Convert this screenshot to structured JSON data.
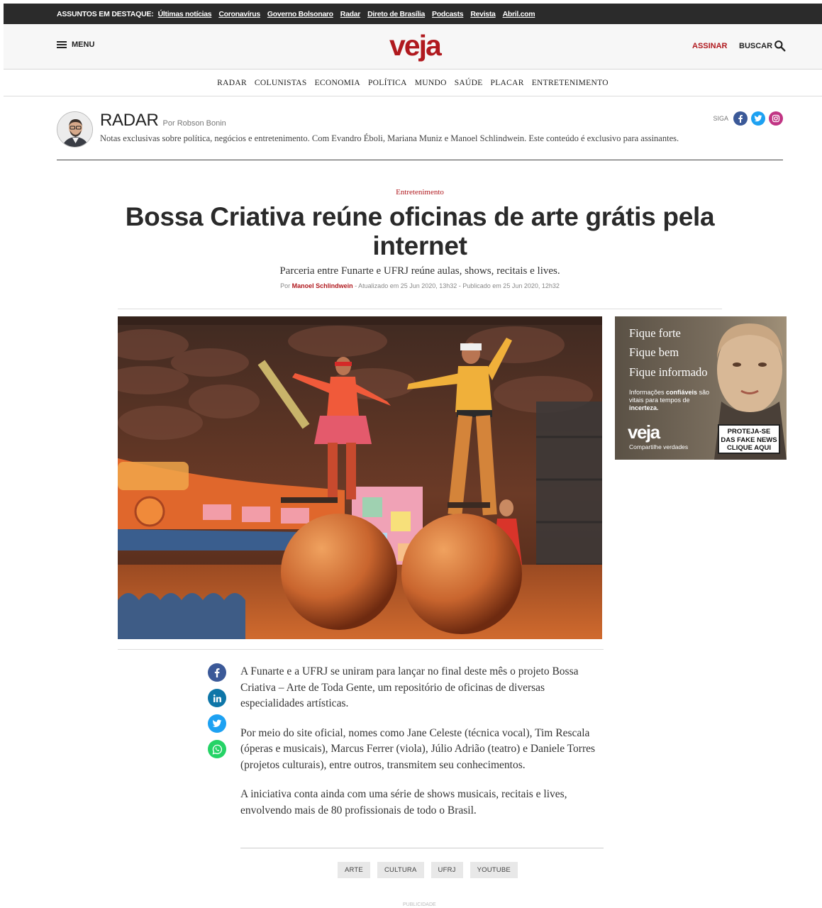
{
  "topbar": {
    "label": "ASSUNTOS EM DESTAQUE:",
    "links": [
      "Últimas notícias",
      "Coronavírus",
      "Governo Bolsonaro",
      "Radar",
      "Direto de Brasília",
      "Podcasts",
      "Revista",
      "Abril.com"
    ]
  },
  "header": {
    "menu_label": "MENU",
    "logo": "veja",
    "subscribe_label": "ASSINAR",
    "search_label": "BUSCAR"
  },
  "nav": [
    "RADAR",
    "COLUNISTAS",
    "ECONOMIA",
    "POLÍTICA",
    "MUNDO",
    "SAÚDE",
    "PLACAR",
    "ENTRETENIMENTO"
  ],
  "column": {
    "title": "RADAR",
    "author": "Por Robson Bonin",
    "description": "Notas exclusivas sobre política, negócios e entretenimento. Com Evandro Éboli, Mariana Muniz e Manoel Schlindwein. Este conteúdo é exclusivo para assinantes.",
    "follow_label": "SIGA",
    "social_colors": {
      "facebook": "#3b5998",
      "twitter": "#1da1f2",
      "instagram": "#c13584"
    }
  },
  "article": {
    "category": "Entretenimento",
    "headline": "Bossa Criativa reúne oficinas de arte grátis pela internet",
    "subhead": "Parceria entre Funarte e UFRJ reúne aulas, shows, recitais e lives.",
    "byline_prefix": "Por",
    "author": "Manoel Schlindwein",
    "byline_dates": "- Atualizado em 25 Jun 2020, 13h32 - Publicado em 25 Jun 2020, 12h32",
    "paragraphs": [
      "A Funarte e a UFRJ se uniram para lançar no final deste mês o projeto Bossa Criativa – Arte de Toda Gente, um repositório de oficinas de diversas especialidades artísticas.",
      "Por meio do site oficial, nomes como Jane Celeste (técnica vocal), Tim Rescala (óperas e musicais), Marcus Ferrer (viola), Júlio Adrião (teatro) e Daniele Torres (projetos culturais), entre outros, transmitem seu conhecimentos.",
      "A iniciativa conta ainda com uma série de shows musicais, recitais e lives, envolvendo mais de 80 profissionais de todo o Brasil."
    ],
    "tags": [
      "ARTE",
      "CULTURA",
      "UFRJ",
      "YOUTUBE"
    ]
  },
  "share": {
    "colors": {
      "facebook": "#3b5998",
      "linkedin": "#0e76a8",
      "twitter": "#1da1f2",
      "whatsapp": "#25d366"
    }
  },
  "ad": {
    "lines": [
      "Fique forte",
      "Fique bem",
      "Fique informado"
    ],
    "small_text_1": "Informações",
    "small_bold_1": "confiáveis",
    "small_text_2": "são vitais para tempos de",
    "small_bold_2": "incerteza.",
    "logo": "veja",
    "tagline": "Compartilhe verdades",
    "cta": [
      "PROTEJA-SE",
      "DAS FAKE NEWS",
      "CLIQUE AQUI"
    ]
  },
  "footer_label": "PUBLICIDADE",
  "colors": {
    "brand": "#b0191e",
    "topbar": "#2b2b2b"
  }
}
